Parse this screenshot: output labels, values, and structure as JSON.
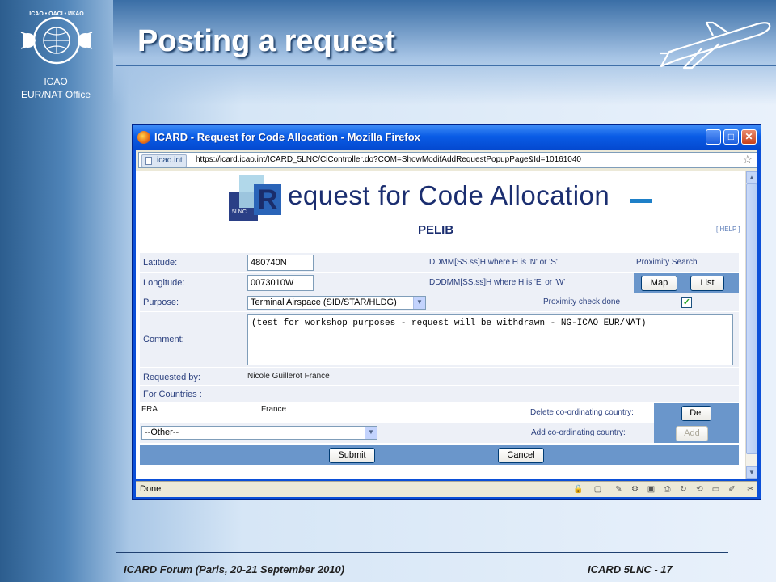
{
  "slide": {
    "title": "Posting a request",
    "logo_caption_1": "ICAO",
    "logo_caption_2": "EUR/NAT Office",
    "footer_left": "ICARD Forum (Paris, 20-21 September 2010)",
    "footer_right": "ICARD 5LNC - 17",
    "logo_ring_text": "ICAO • OACI • ИКАО"
  },
  "window": {
    "title": "ICARD - Request for Code Allocation - Mozilla Firefox",
    "site_identity": "icao.int",
    "url": "https://icard.icao.int/ICARD_5LNC/CiController.do?COM=ShowModifAddRequestPopupPage&Id=10161040",
    "status": "Done"
  },
  "page": {
    "logo_letter": "R",
    "logo_small": "5LNC",
    "heading": "equest for Code Allocation",
    "name": "PELIB",
    "help": "[ HELP ]",
    "latitude_label": "Latitude:",
    "latitude_value": "480740N",
    "latitude_hint": "DDMM[SS.ss]H where H is 'N' or 'S'",
    "proximity_search": "Proximity Search",
    "longitude_label": "Longitude:",
    "longitude_value": "0073010W",
    "longitude_hint": "DDDMM[SS.ss]H where H is 'E' or 'W'",
    "map_button": "Map",
    "list_button": "List",
    "purpose_label": "Purpose:",
    "purpose_value": "Terminal Airspace (SID/STAR/HLDG)",
    "proximity_check": "Proximity check done",
    "proximity_checked": true,
    "comment_label": "Comment:",
    "comment_value": "(test for workshop purposes - request will be withdrawn - NG-ICAO EUR/NAT)",
    "requested_by_label": "Requested by:",
    "requested_by_value": "Nicole Guillerot France",
    "for_countries_label": "For Countries :",
    "country_code": "FRA",
    "country_name": "France",
    "delete_label": "Delete co-ordinating country:",
    "del_button": "Del",
    "other_select": "--Other--",
    "add_label": "Add co-ordinating country:",
    "add_button": "Add",
    "submit_button": "Submit",
    "cancel_button": "Cancel"
  },
  "colors": {
    "brand_navy": "#1b2e70",
    "row_bg": "#edf0f7",
    "accent_blue": "#6a96cb"
  }
}
